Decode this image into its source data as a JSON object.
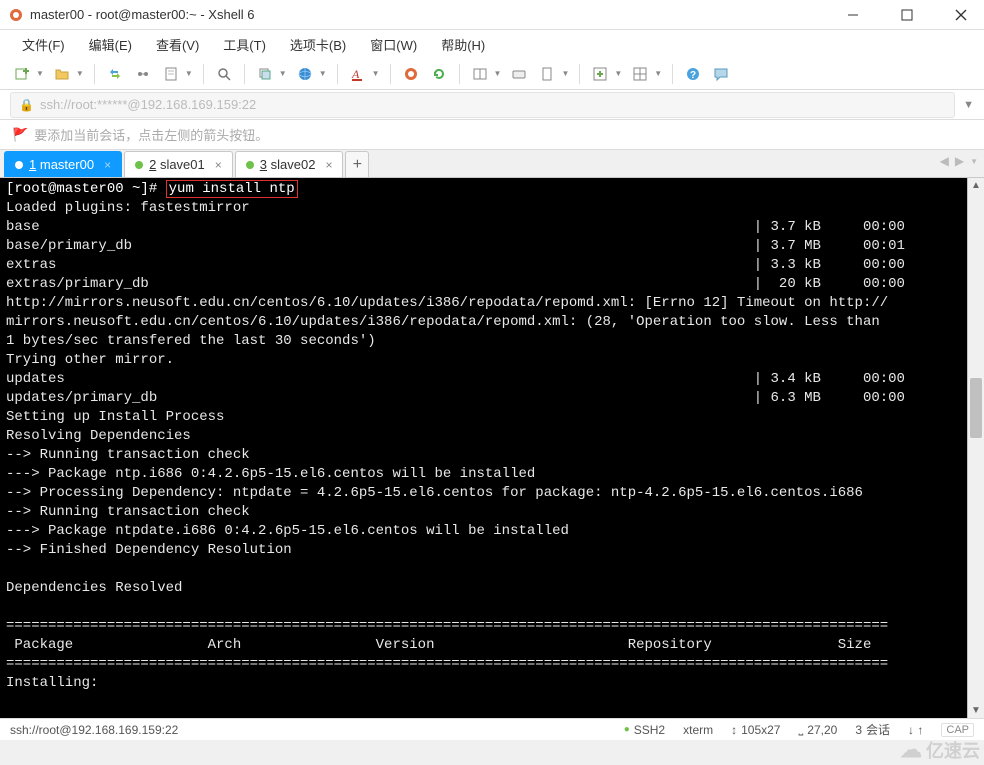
{
  "window": {
    "title": "master00 - root@master00:~ - Xshell 6"
  },
  "menu": {
    "items": [
      "文件(F)",
      "编辑(E)",
      "查看(V)",
      "工具(T)",
      "选项卡(B)",
      "窗口(W)",
      "帮助(H)"
    ]
  },
  "connection": {
    "text": "ssh://root:******@192.168.169.159:22"
  },
  "hint": {
    "text": "要添加当前会话，点击左侧的箭头按钮。"
  },
  "tabs": [
    {
      "num": "1",
      "label": "master00",
      "active": true
    },
    {
      "num": "2",
      "label": "slave01",
      "active": false
    },
    {
      "num": "3",
      "label": "slave02",
      "active": false
    }
  ],
  "terminal": {
    "prompt": "[root@master00 ~]# ",
    "command": "yum install ntp",
    "lines": [
      "Loaded plugins: fastestmirror",
      "base                                                                                     | 3.7 kB     00:00",
      "base/primary_db                                                                          | 3.7 MB     00:01",
      "extras                                                                                   | 3.3 kB     00:00",
      "extras/primary_db                                                                        |  20 kB     00:00",
      "http://mirrors.neusoft.edu.cn/centos/6.10/updates/i386/repodata/repomd.xml: [Errno 12] Timeout on http://",
      "mirrors.neusoft.edu.cn/centos/6.10/updates/i386/repodata/repomd.xml: (28, 'Operation too slow. Less than ",
      "1 bytes/sec transfered the last 30 seconds')",
      "Trying other mirror.",
      "updates                                                                                  | 3.4 kB     00:00",
      "updates/primary_db                                                                       | 6.3 MB     00:00",
      "Setting up Install Process",
      "Resolving Dependencies",
      "--> Running transaction check",
      "---> Package ntp.i686 0:4.2.6p5-15.el6.centos will be installed",
      "--> Processing Dependency: ntpdate = 4.2.6p5-15.el6.centos for package: ntp-4.2.6p5-15.el6.centos.i686",
      "--> Running transaction check",
      "---> Package ntpdate.i686 0:4.2.6p5-15.el6.centos will be installed",
      "--> Finished Dependency Resolution",
      "",
      "Dependencies Resolved",
      "",
      "=========================================================================================================",
      " Package                Arch                Version                       Repository               Size",
      "=========================================================================================================",
      "Installing:"
    ]
  },
  "status": {
    "conn": "ssh://root@192.168.169.159:22",
    "proto": "SSH2",
    "term": "xterm",
    "size": "105x27",
    "pos": "27,20",
    "sessions_label": "会话",
    "sessions_count": "3",
    "cap": "CAP"
  },
  "watermark": {
    "text": "亿速云"
  }
}
